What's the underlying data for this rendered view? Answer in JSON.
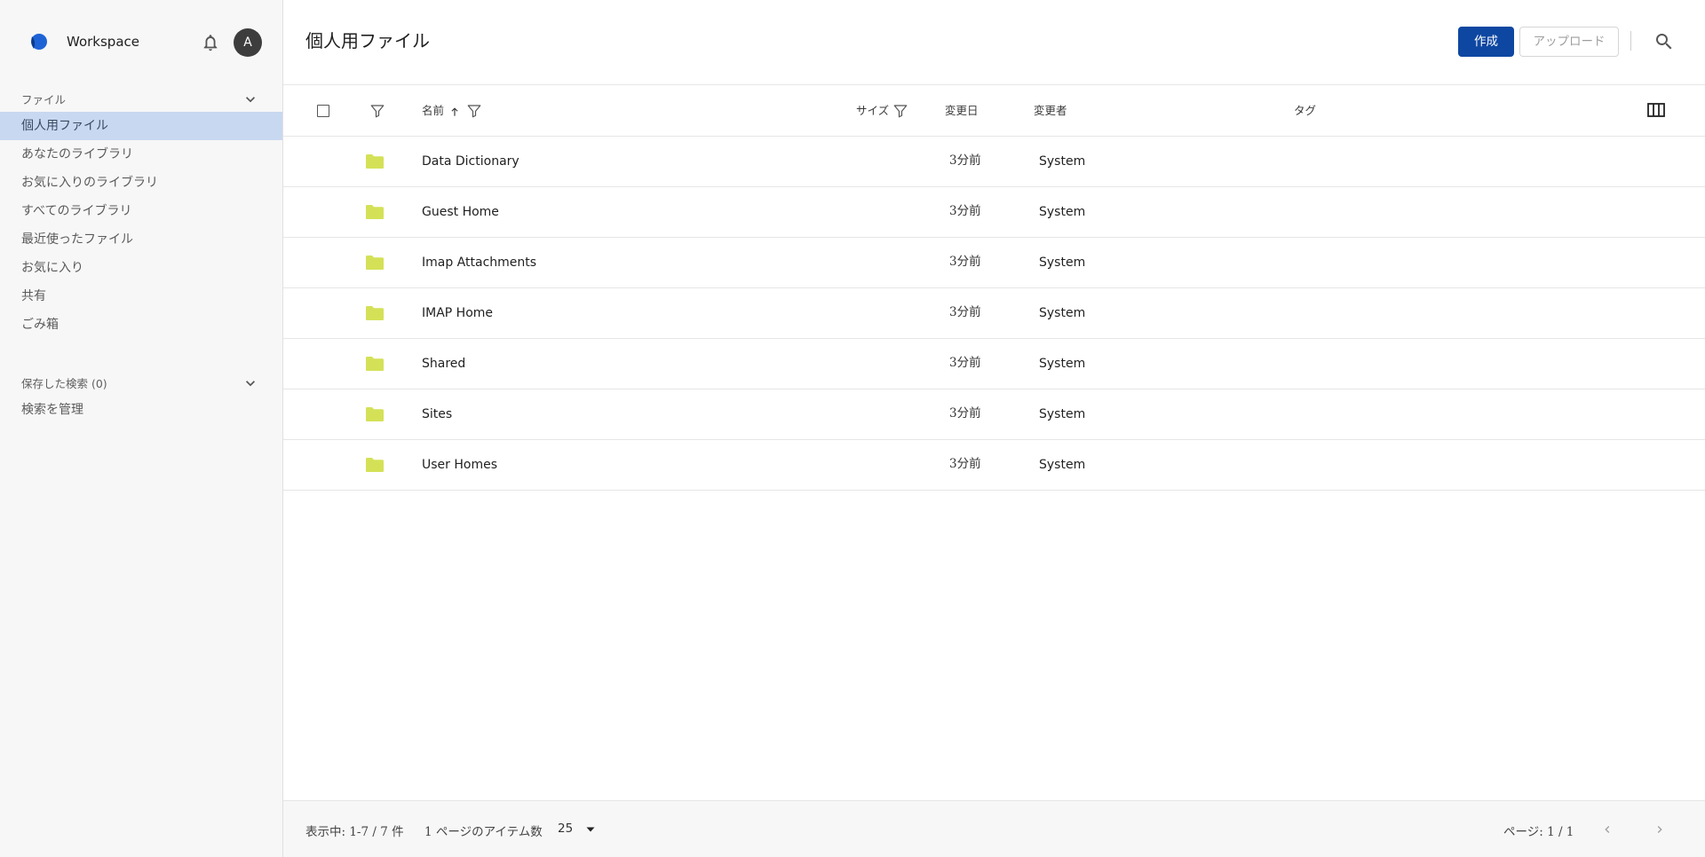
{
  "app": {
    "brand_name": "Workspace",
    "avatar_initial": "A",
    "accent_color": "#0d47a1",
    "folder_color": "#d4e157",
    "active_nav_color": "#c8d8f0"
  },
  "sidebar": {
    "files_section_label": "ファイル",
    "items": [
      {
        "label": "個人用ファイル",
        "active": true
      },
      {
        "label": "あなたのライブラリ"
      },
      {
        "label": "お気に入りのライブラリ"
      },
      {
        "label": "すべてのライブラリ"
      },
      {
        "label": "最近使ったファイル"
      },
      {
        "label": "お気に入り"
      },
      {
        "label": "共有"
      },
      {
        "label": "ごみ箱"
      }
    ],
    "saved_search_label": "保存した検索 (0)",
    "manage_search_label": "検索を管理"
  },
  "header": {
    "title": "個人用ファイル",
    "create_label": "作成",
    "upload_label": "アップロード"
  },
  "table": {
    "columns": {
      "name": "名前",
      "size": "サイズ",
      "modified": "変更日",
      "modifier": "変更者",
      "tags": "タグ"
    },
    "sort_column": "name",
    "sort_direction": "ascending",
    "rows": [
      {
        "name": "Data Dictionary",
        "modified": "3分前",
        "modifier": "System"
      },
      {
        "name": "Guest Home",
        "modified": "3分前",
        "modifier": "System"
      },
      {
        "name": "Imap Attachments",
        "modified": "3分前",
        "modifier": "System"
      },
      {
        "name": "IMAP Home",
        "modified": "3分前",
        "modifier": "System"
      },
      {
        "name": "Shared",
        "modified": "3分前",
        "modifier": "System"
      },
      {
        "name": "Sites",
        "modified": "3分前",
        "modifier": "System"
      },
      {
        "name": "User Homes",
        "modified": "3分前",
        "modifier": "System"
      }
    ]
  },
  "footer": {
    "range_text": "表示中: 1-7 / 7 件",
    "per_page_label": "1 ページのアイテム数",
    "per_page_value": "25",
    "page_text": "ページ: 1 / 1"
  }
}
